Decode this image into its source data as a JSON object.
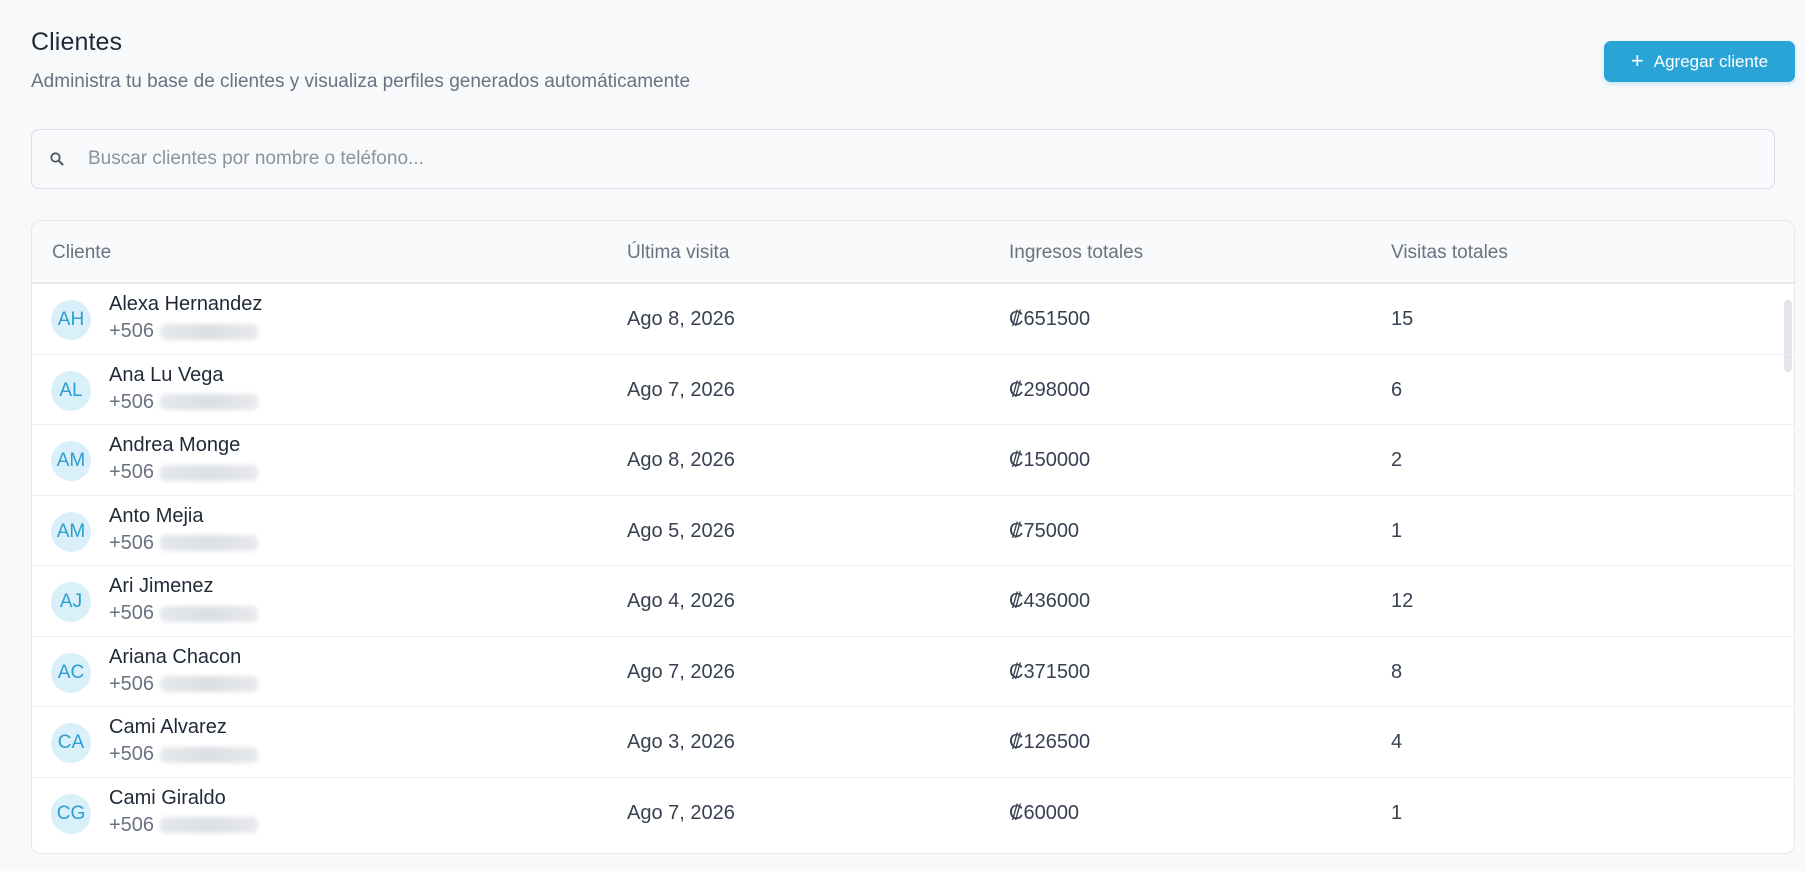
{
  "header": {
    "title": "Clientes",
    "subtitle": "Administra tu base de clientes y visualiza perfiles generados automáticamente",
    "add_button_label": "Agregar cliente"
  },
  "search": {
    "placeholder": "Buscar clientes por nombre o teléfono...",
    "value": ""
  },
  "table": {
    "columns": [
      "Cliente",
      "Última visita",
      "Ingresos totales",
      "Visitas totales"
    ],
    "rows": [
      {
        "initials": "AH",
        "name": "Alexa Hernandez",
        "phone_prefix": "+506",
        "last_visit": "Ago 8, 2026",
        "revenue": "₡651500",
        "visits": "15"
      },
      {
        "initials": "AL",
        "name": "Ana Lu Vega",
        "phone_prefix": "+506",
        "last_visit": "Ago 7, 2026",
        "revenue": "₡298000",
        "visits": "6"
      },
      {
        "initials": "AM",
        "name": "Andrea Monge",
        "phone_prefix": "+506",
        "last_visit": "Ago 8, 2026",
        "revenue": "₡150000",
        "visits": "2"
      },
      {
        "initials": "AM",
        "name": "Anto Mejia",
        "phone_prefix": "+506",
        "last_visit": "Ago 5, 2026",
        "revenue": "₡75000",
        "visits": "1"
      },
      {
        "initials": "AJ",
        "name": "Ari Jimenez",
        "phone_prefix": "+506",
        "last_visit": "Ago 4, 2026",
        "revenue": "₡436000",
        "visits": "12"
      },
      {
        "initials": "AC",
        "name": "Ariana Chacon",
        "phone_prefix": "+506",
        "last_visit": "Ago 7, 2026",
        "revenue": "₡371500",
        "visits": "8"
      },
      {
        "initials": "CA",
        "name": "Cami Alvarez",
        "phone_prefix": "+506",
        "last_visit": "Ago 3, 2026",
        "revenue": "₡126500",
        "visits": "4"
      },
      {
        "initials": "CG",
        "name": "Cami Giraldo",
        "phone_prefix": "+506",
        "last_visit": "Ago 7, 2026",
        "revenue": "₡60000",
        "visits": "1"
      }
    ]
  },
  "colors": {
    "accent": "#2aa4d6",
    "avatar_bg": "#d9eff9",
    "avatar_text": "#2a9fd0"
  },
  "icons": {
    "search": "search-icon",
    "add": "plus-icon"
  }
}
